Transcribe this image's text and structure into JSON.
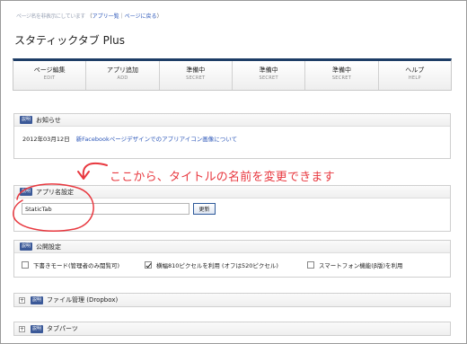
{
  "header": {
    "blurred_text": "ページ名を非表示にしています",
    "back_link_open": "（",
    "app_list_link": "アプリ一覧",
    "separator": "｜",
    "page_back_link": "ページに戻る",
    "back_link_close": "）",
    "app_title": "スタティックタブ Plus"
  },
  "nav": {
    "items": [
      {
        "label": "ページ編集",
        "sub": "EDIT"
      },
      {
        "label": "アプリ追加",
        "sub": "ADD"
      },
      {
        "label": "準備中",
        "sub": "SECRET"
      },
      {
        "label": "準備中",
        "sub": "SECRET"
      },
      {
        "label": "準備中",
        "sub": "SECRET"
      },
      {
        "label": "ヘルプ",
        "sub": "HELP"
      }
    ]
  },
  "badge_label": "説明",
  "news": {
    "title": "お知らせ",
    "date": "2012年03月12日",
    "link": "新Facebookページデザインでのアプリアイコン画像について"
  },
  "app_name": {
    "title": "アプリ名設定",
    "input_value": "StaticTab",
    "button": "更新"
  },
  "public_settings": {
    "title": "公開設定",
    "options": [
      {
        "label": "下書きモード(管理者のみ閲覧可)",
        "checked": false
      },
      {
        "label": "横幅810ピクセルを利用 (オフは520ピクセル)",
        "checked": true
      },
      {
        "label": "スマートフォン機能(β版)を利用",
        "checked": false
      }
    ]
  },
  "file_manager": {
    "plus": "+",
    "title": "ファイル管理 (Dropbox)"
  },
  "tab_parts": {
    "plus": "+",
    "title": "タブパーツ"
  },
  "annotation": {
    "text": "ここから、タイトルの名前を変更できます",
    "color": "#e8383f"
  }
}
